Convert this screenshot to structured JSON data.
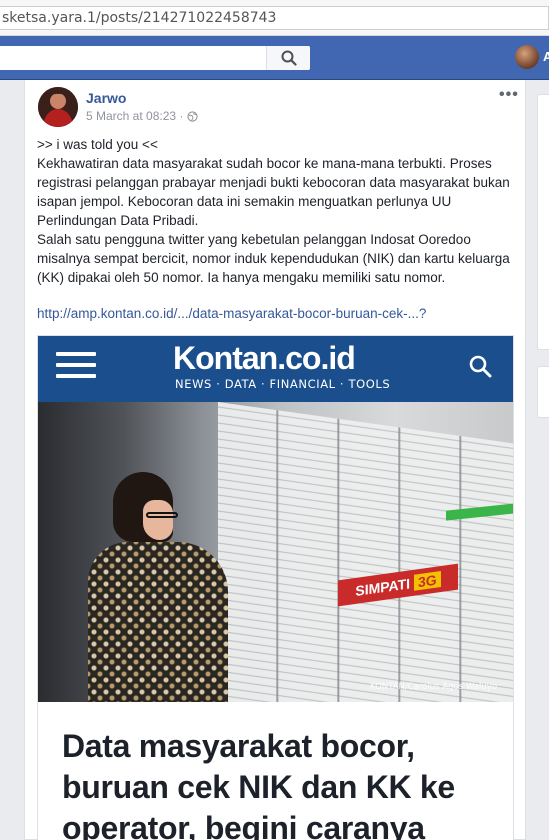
{
  "browser": {
    "url": "sketsa.yara.1/posts/214271022458743"
  },
  "topbar": {
    "search_placeholder": "",
    "profile_initial": "A"
  },
  "post": {
    "author": "Jarwo",
    "timestamp": "5 March at 08:23 ·",
    "more_label": "•••",
    "paragraphs": [
      ">> i was told you <<",
      "Kekhawatiran data masyarakat sudah bocor ke mana-mana terbukti. Proses registrasi pelanggan prabayar menjadi bukti kebocoran data masyarakat bukan isapan jempol. Kebocoran data ini semakin menguatkan perlunya UU Perlindungan Data Pribadi.",
      "Salah satu pengguna twitter yang kebetulan pelanggan Indosat Ooredoo misalnya sempat bercicit, nomor induk kependudukan (NIK) dan kartu keluarga (KK) dipakai oleh 50 nomor. Ia hanya mengaku memiliki satu nomor."
    ],
    "link": "http://amp.kontan.co.id/.../data-masyarakat-bocor-buruan-cek-...?"
  },
  "preview": {
    "logo": "Kontan.co.id",
    "tagline": "NEWS · DATA · FINANCIAL · TOOLS",
    "photo_caption": "KONTAN/Carolus Agus Waluyo",
    "board_brand": "SIMPATI",
    "board_badge": "3G",
    "headline": "Data masyarakat bocor, buruan cek NIK dan KK ke operator, begini caranya"
  },
  "colors": {
    "facebook_blue": "#4267b2",
    "link_blue": "#365899",
    "kontan_blue": "#1a4e8c"
  }
}
